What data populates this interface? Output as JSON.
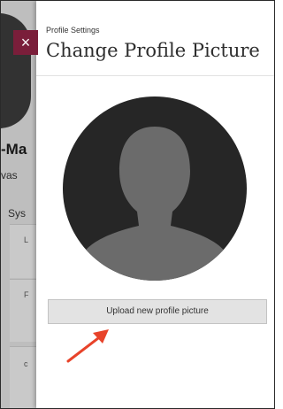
{
  "background_page": {
    "name_fragment": "-Ma",
    "sub_fragment": "vas",
    "section_fragment": "Sys",
    "card_letters": [
      "L",
      "F",
      "c"
    ]
  },
  "close_button": {
    "glyph": "×"
  },
  "panel": {
    "eyebrow": "Profile Settings",
    "title": "Change Profile Picture",
    "upload_label": "Upload new profile picture"
  },
  "colors": {
    "accent": "#7a1e3a",
    "avatar_bg": "#262626",
    "avatar_figure": "#6b6b6b",
    "arrow": "#e8432a"
  },
  "icons": {
    "avatar": "default-user-silhouette-icon",
    "arrow": "arrow-up-right-icon",
    "close": "close-icon"
  }
}
